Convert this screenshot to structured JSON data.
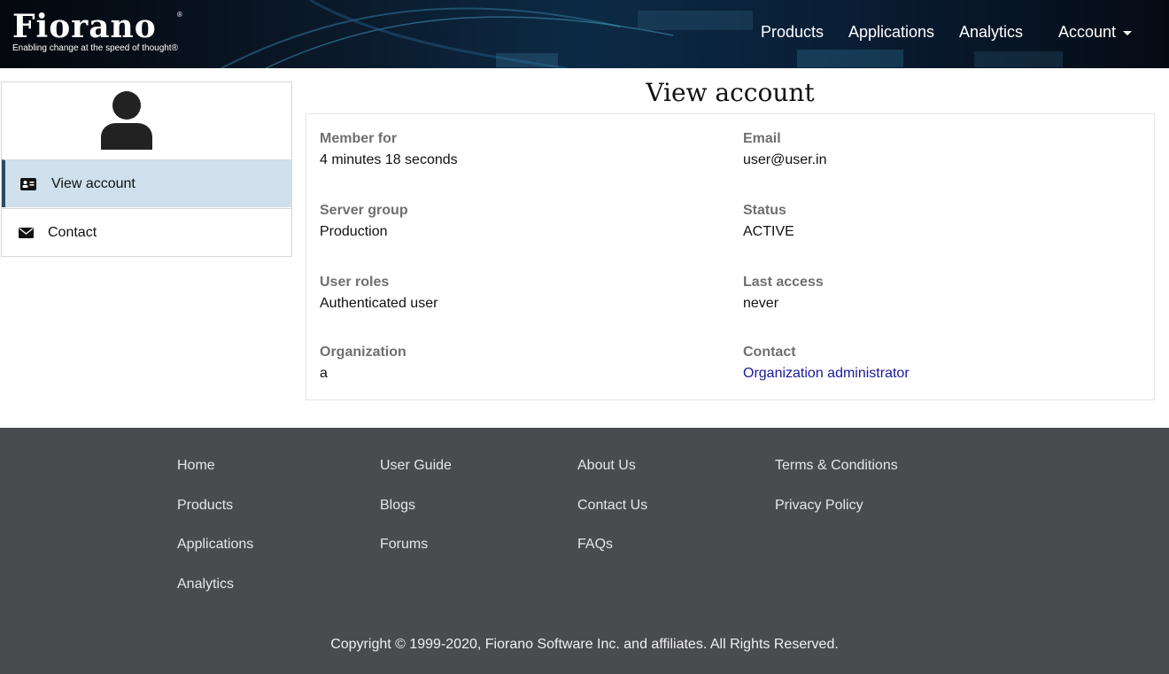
{
  "brand": {
    "name": "Fiorano",
    "registered": "®",
    "tagline": "Enabling change at the speed of thought®"
  },
  "nav": {
    "products": "Products",
    "applications": "Applications",
    "analytics": "Analytics",
    "account": "Account"
  },
  "sidebar": {
    "items": [
      {
        "label": "View account",
        "icon": "id-card-icon",
        "active": true
      },
      {
        "label": "Contact",
        "icon": "envelope-icon",
        "active": false
      }
    ]
  },
  "main": {
    "title": "View account",
    "fields": {
      "member_for": {
        "label": "Member for",
        "value": "4 minutes 18 seconds"
      },
      "email": {
        "label": "Email",
        "value": "user@user.in"
      },
      "server_group": {
        "label": "Server group",
        "value": "Production"
      },
      "status": {
        "label": "Status",
        "value": "ACTIVE"
      },
      "user_roles": {
        "label": "User roles",
        "value": "Authenticated user"
      },
      "last_access": {
        "label": "Last access",
        "value": "never"
      },
      "organization": {
        "label": "Organization",
        "value": "a"
      },
      "contact": {
        "label": "Contact",
        "value": "Organization administrator"
      }
    }
  },
  "footer": {
    "col1": [
      "Home",
      "Products",
      "Applications",
      "Analytics"
    ],
    "col2": [
      "User Guide",
      "Blogs",
      "Forums"
    ],
    "col3": [
      "About Us",
      "Contact Us",
      "FAQs"
    ],
    "col4": [
      "Terms & Conditions",
      "Privacy Policy"
    ],
    "copyright": "Copyright © 1999-2020, Fiorano Software Inc. and affiliates. All Rights Reserved."
  },
  "colors": {
    "header_bg": "#0b1a2c",
    "active_item_bg": "#cfe0ec",
    "active_item_bar": "#2b4a66",
    "footer_bg": "#4a4b4e",
    "link": "#1a1a9c"
  }
}
